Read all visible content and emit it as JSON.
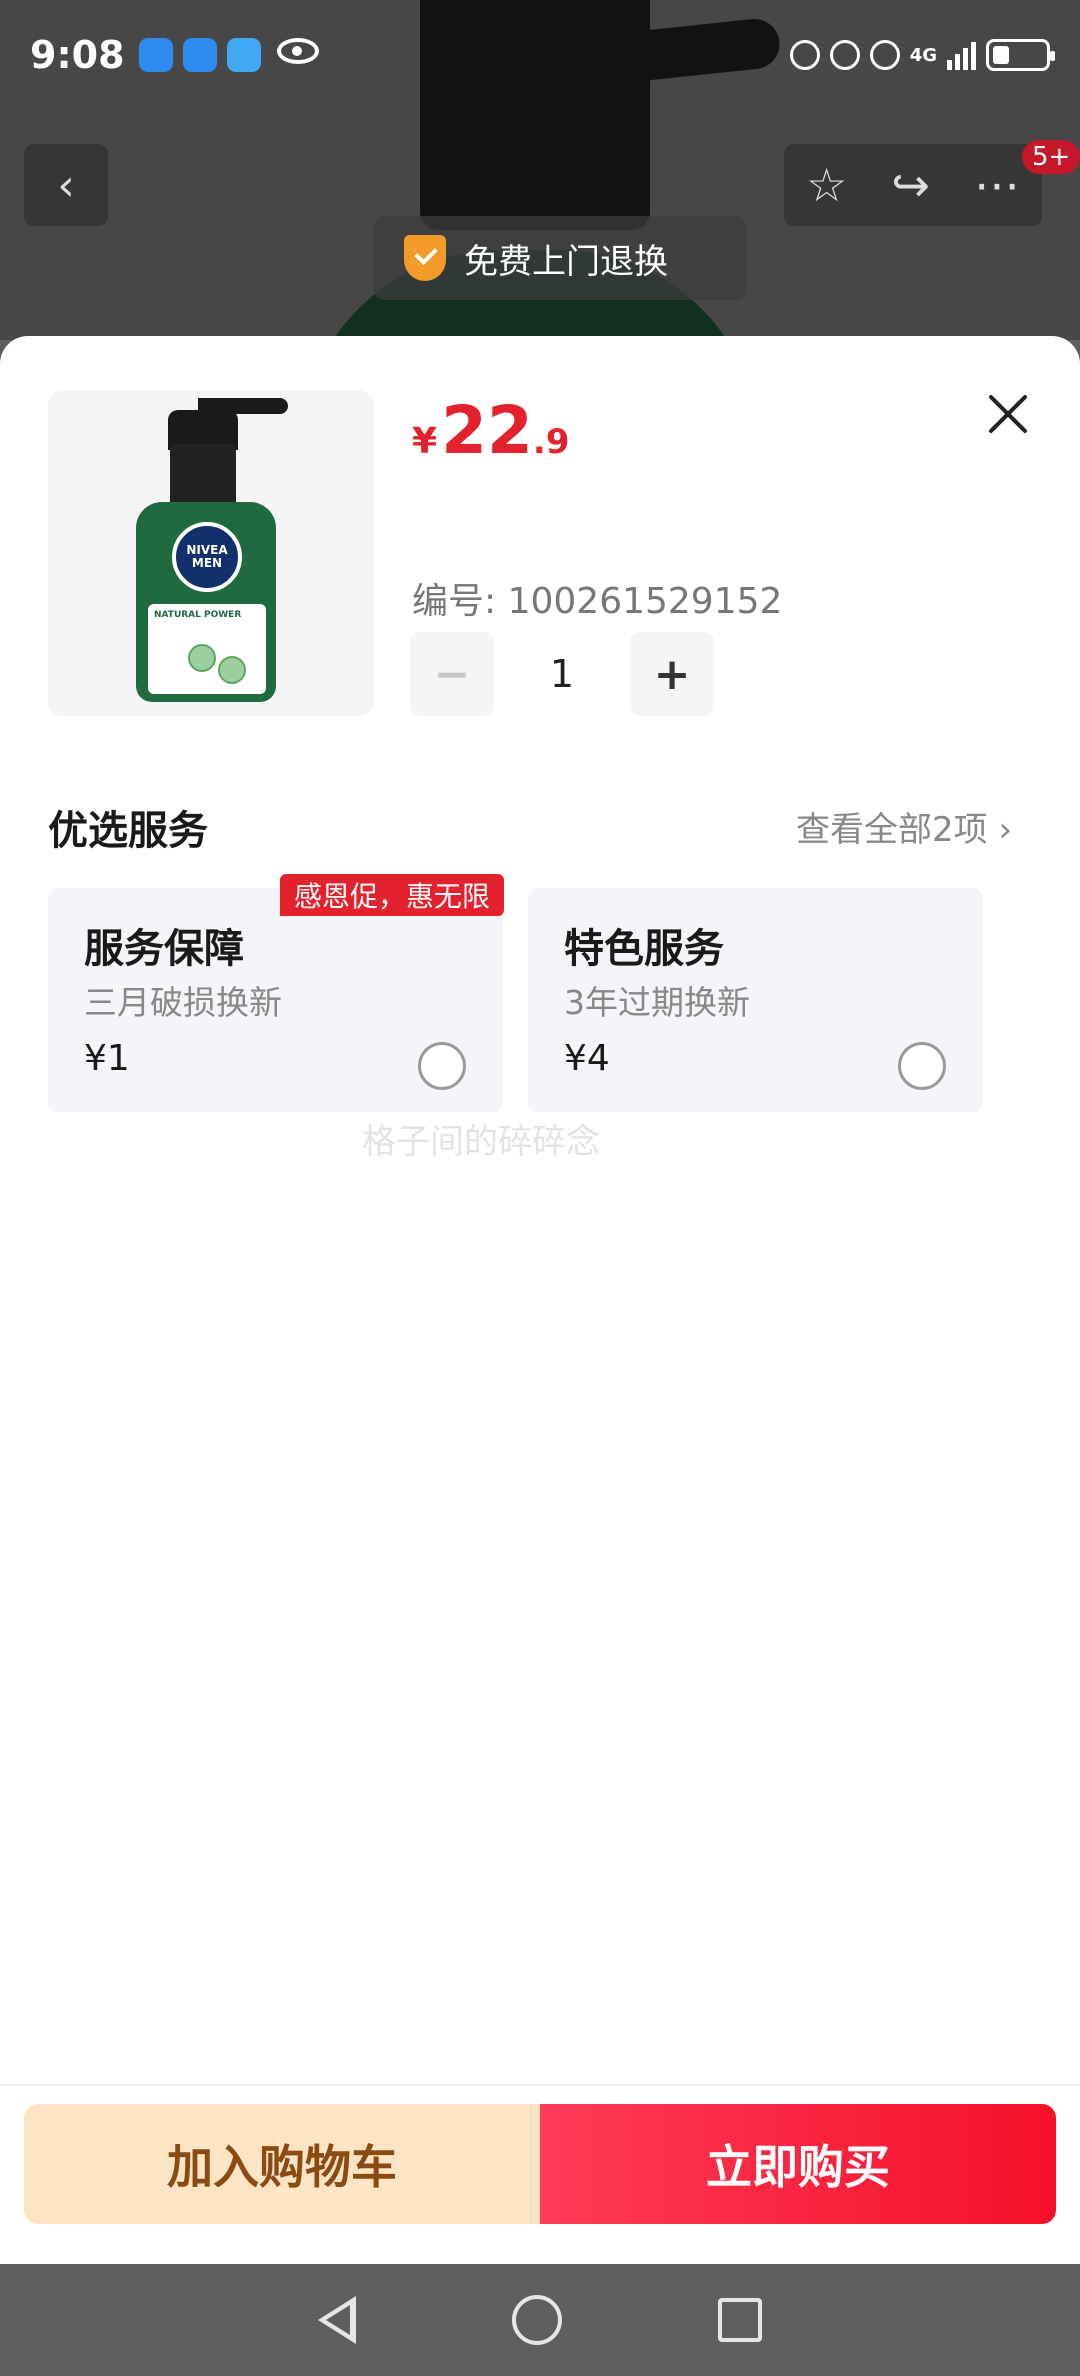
{
  "status_bar": {
    "time": "9:08",
    "network": "4G"
  },
  "background_page": {
    "return_banner": "免费上门退换",
    "notification_badge": "5+"
  },
  "sheet": {
    "product": {
      "brand_top": "NIVEA",
      "brand_bottom": "MEN",
      "label_line": "NATURAL POWER",
      "price_symbol": "¥",
      "price_integer": "22",
      "price_decimal": ".9",
      "sku_text": "编号: 100261529152"
    },
    "quantity": {
      "value": "1",
      "minus_label": "−",
      "plus_label": "+"
    },
    "services": {
      "title": "优选服务",
      "more_label": "查看全部2项 ›",
      "promo_tag": "感恩促，惠无限",
      "items": [
        {
          "name": "服务保障",
          "desc": "三月破损换新",
          "price": "¥1"
        },
        {
          "name": "特色服务",
          "desc": "3年过期换新",
          "price": "¥4"
        }
      ]
    },
    "watermark": "格子间的碎碎念",
    "actions": {
      "add_to_cart": "加入购物车",
      "buy_now": "立即购买"
    }
  },
  "colors": {
    "accent_red": "#e4222d",
    "cart_bg": "#fde4c4",
    "cart_text": "#8b4a12",
    "shield_orange": "#f39a2b"
  }
}
